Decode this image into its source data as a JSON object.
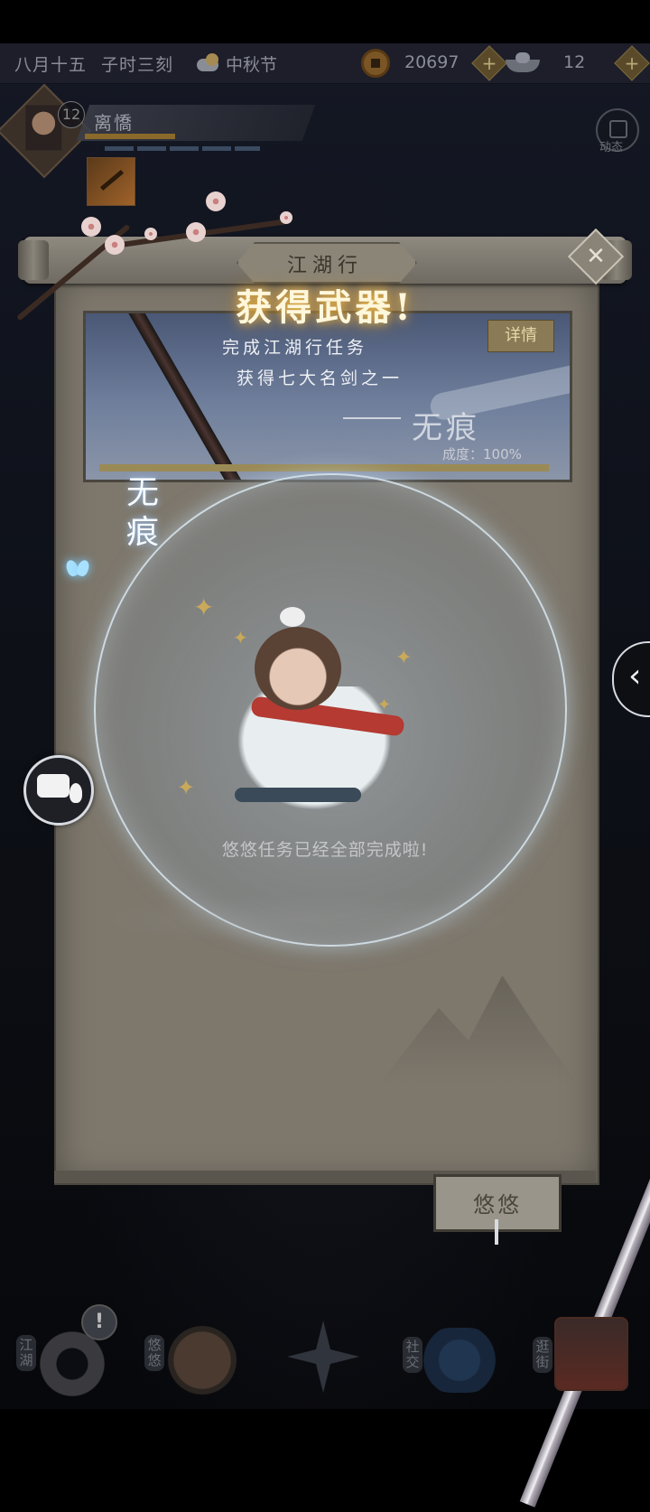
{
  "status": {
    "date": "八月十五",
    "time": "子时三刻",
    "weather_icon": "cloud-sun-icon",
    "festival": "中秋节",
    "coins": "20697",
    "ingots": "12",
    "plus_label": "+"
  },
  "player": {
    "level": "12",
    "name": "离憍"
  },
  "dynamics": {
    "label": "动态"
  },
  "dialog": {
    "title": "江湖行",
    "close_label": "✕",
    "obtain_label": "获得武器!",
    "detail_label": "详情",
    "banner_line1": "完成江湖行任务",
    "banner_line2": "获得七大名剑之一",
    "banner_weapon": "无痕",
    "banner_progress": "成度：100%",
    "weapon_name": "无痕",
    "complete_text": "悠悠任务已经全部完成啦!",
    "npc_name": "悠悠"
  },
  "side": {
    "arrow_label": "‹"
  },
  "bottom_nav": {
    "alert": "!",
    "items": [
      {
        "label": "江湖",
        "icon": "ring-disc-icon"
      },
      {
        "label": "悠悠",
        "icon": "crane-moon-icon"
      },
      {
        "label": "",
        "icon": "compass-star-icon"
      },
      {
        "label": "社交",
        "icon": "wave-icon"
      },
      {
        "label": "逛街",
        "icon": "basket-icon"
      }
    ]
  },
  "colors": {
    "gold_glow": "#e8b64a",
    "parchment": "#7d776c",
    "status_bar": "#1e202a"
  }
}
